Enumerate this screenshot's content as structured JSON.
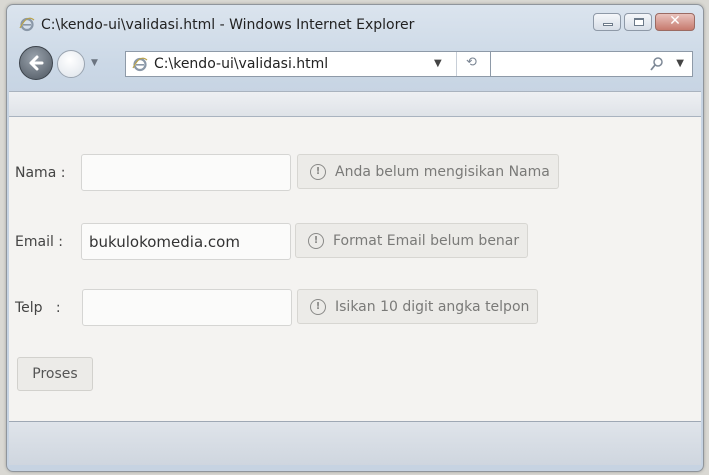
{
  "window": {
    "title": "C:\\kendo-ui\\validasi.html - Windows Internet Explorer",
    "close_glyph": "✕"
  },
  "navigation": {
    "address": "C:\\kendo-ui\\validasi.html",
    "refresh_glyph": "⟲",
    "search_value": ""
  },
  "form": {
    "fields": [
      {
        "label": "Nama :",
        "value": "",
        "error": "Anda belum mengisikan Nama"
      },
      {
        "label": "Email :",
        "value": "bukulokomedia.com",
        "error": "Format Email belum benar"
      },
      {
        "label": "Telp   :",
        "value": "",
        "error": "Isikan 10 digit angka telpon"
      }
    ],
    "submit_label": "Proses",
    "warning_glyph": "!"
  },
  "colors": {
    "accent": "#cbd8e6",
    "tooltip_bg": "#ecebe8",
    "tooltip_text": "#7a7a78"
  }
}
